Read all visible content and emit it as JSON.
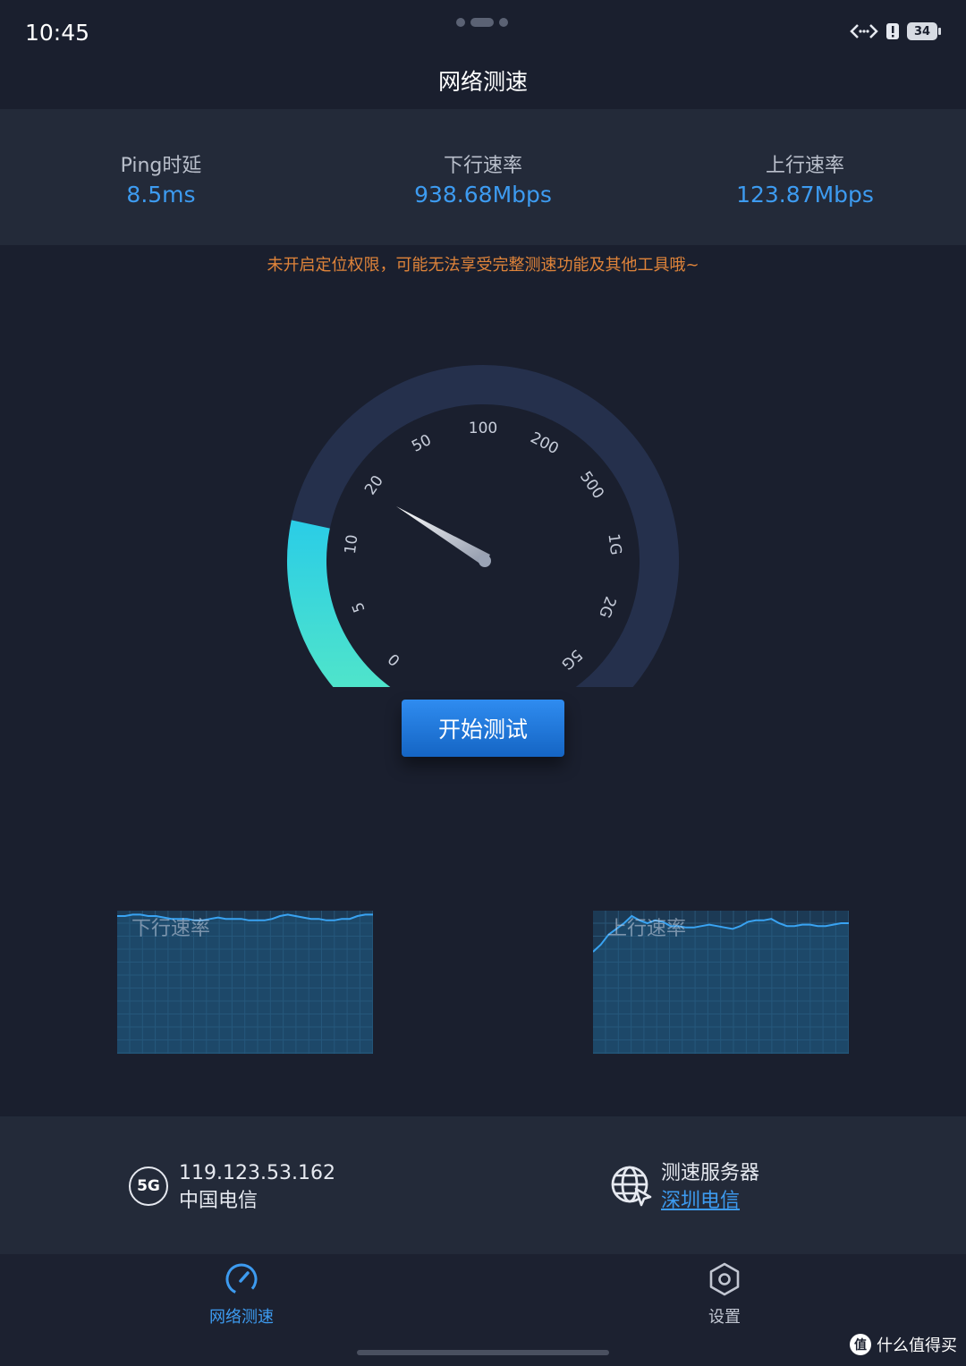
{
  "status_bar": {
    "time": "10:45",
    "battery": "34"
  },
  "app": {
    "title": "网络测速"
  },
  "stats": [
    {
      "label": "Ping时延",
      "value": "8.5ms"
    },
    {
      "label": "下行速率",
      "value": "938.68Mbps"
    },
    {
      "label": "上行速率",
      "value": "123.87Mbps"
    }
  ],
  "warning": "未开启定位权限，可能无法享受完整测速功能及其他工具哦~",
  "gauge": {
    "ticks": [
      "0",
      "5",
      "10",
      "20",
      "50",
      "100",
      "200",
      "500",
      "1G",
      "2G",
      "5G"
    ],
    "level_fraction": 0.24,
    "colors": {
      "track": "#25304c",
      "fill_start": "#55e8c6",
      "fill_end": "#2bcde6"
    }
  },
  "start_button": {
    "label": "开始测试"
  },
  "charts": {
    "download": {
      "label": "下行速率",
      "values": [
        0.95,
        0.95,
        0.96,
        0.96,
        0.95,
        0.95,
        0.94,
        0.93,
        0.93,
        0.93,
        0.92,
        0.92,
        0.93,
        0.94,
        0.93,
        0.93,
        0.93,
        0.92,
        0.92,
        0.92,
        0.93,
        0.95,
        0.96,
        0.95,
        0.94,
        0.93,
        0.93,
        0.92,
        0.92,
        0.93,
        0.93,
        0.95,
        0.96,
        0.96
      ]
    },
    "upload": {
      "label": "上行速率",
      "values": [
        0.7,
        0.75,
        0.82,
        0.86,
        0.9,
        0.95,
        0.92,
        0.9,
        0.92,
        0.91,
        0.88,
        0.88,
        0.87,
        0.87,
        0.88,
        0.89,
        0.88,
        0.87,
        0.86,
        0.88,
        0.91,
        0.92,
        0.92,
        0.93,
        0.9,
        0.88,
        0.88,
        0.89,
        0.89,
        0.88,
        0.88,
        0.89,
        0.9,
        0.9
      ]
    }
  },
  "network": {
    "type": "5G",
    "ip": "119.123.53.162",
    "carrier": "中国电信"
  },
  "server": {
    "label": "测速服务器",
    "name": "深圳电信"
  },
  "nav": [
    {
      "label": "网络测速",
      "active": true
    },
    {
      "label": "设置",
      "active": false
    }
  ],
  "watermark": {
    "logo": "值",
    "text": "什么值得买"
  }
}
